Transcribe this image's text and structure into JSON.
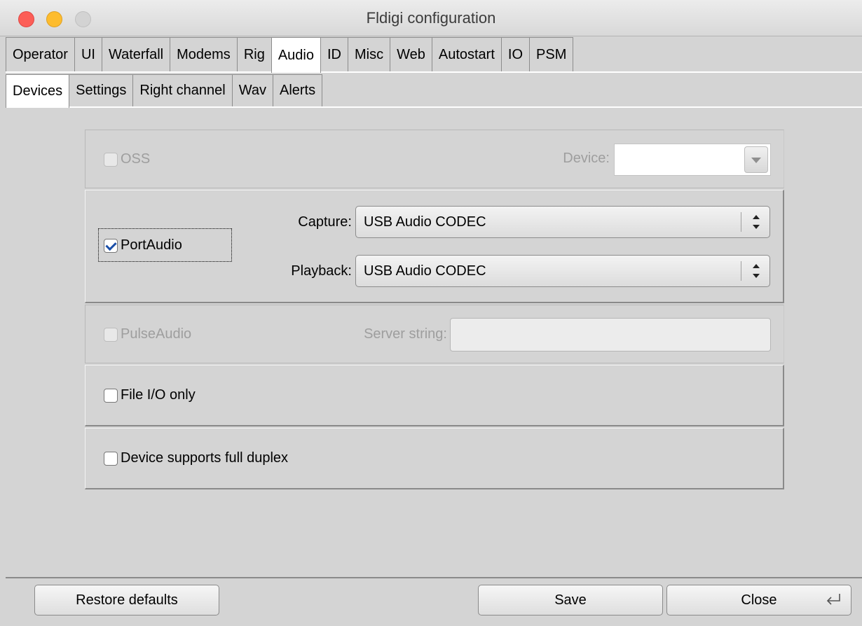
{
  "window": {
    "title": "Fldigi configuration"
  },
  "tabs": [
    {
      "label": "Operator"
    },
    {
      "label": "UI"
    },
    {
      "label": "Waterfall"
    },
    {
      "label": "Modems"
    },
    {
      "label": "Rig"
    },
    {
      "label": "Audio",
      "selected": true
    },
    {
      "label": "ID"
    },
    {
      "label": "Misc"
    },
    {
      "label": "Web"
    },
    {
      "label": "Autostart"
    },
    {
      "label": "IO"
    },
    {
      "label": "PSM"
    }
  ],
  "subtabs": [
    {
      "label": "Devices",
      "selected": true
    },
    {
      "label": "Settings"
    },
    {
      "label": "Right channel"
    },
    {
      "label": "Wav"
    },
    {
      "label": "Alerts"
    }
  ],
  "oss": {
    "label": "OSS",
    "checked": false,
    "enabled": false,
    "device_label": "Device:",
    "device_value": ""
  },
  "portaudio": {
    "label": "PortAudio",
    "checked": true,
    "capture_label": "Capture:",
    "capture_value": "USB Audio CODEC",
    "playback_label": "Playback:",
    "playback_value": "USB Audio CODEC"
  },
  "pulseaudio": {
    "label": "PulseAudio",
    "checked": false,
    "enabled": false,
    "server_label": "Server string:",
    "server_value": ""
  },
  "file_io": {
    "label": "File I/O only",
    "checked": false
  },
  "full_duplex": {
    "label": "Device supports full duplex",
    "checked": false
  },
  "buttons": {
    "restore": "Restore defaults",
    "save": "Save",
    "close": "Close"
  },
  "icons": {
    "close_enter": "enter-key-icon"
  }
}
